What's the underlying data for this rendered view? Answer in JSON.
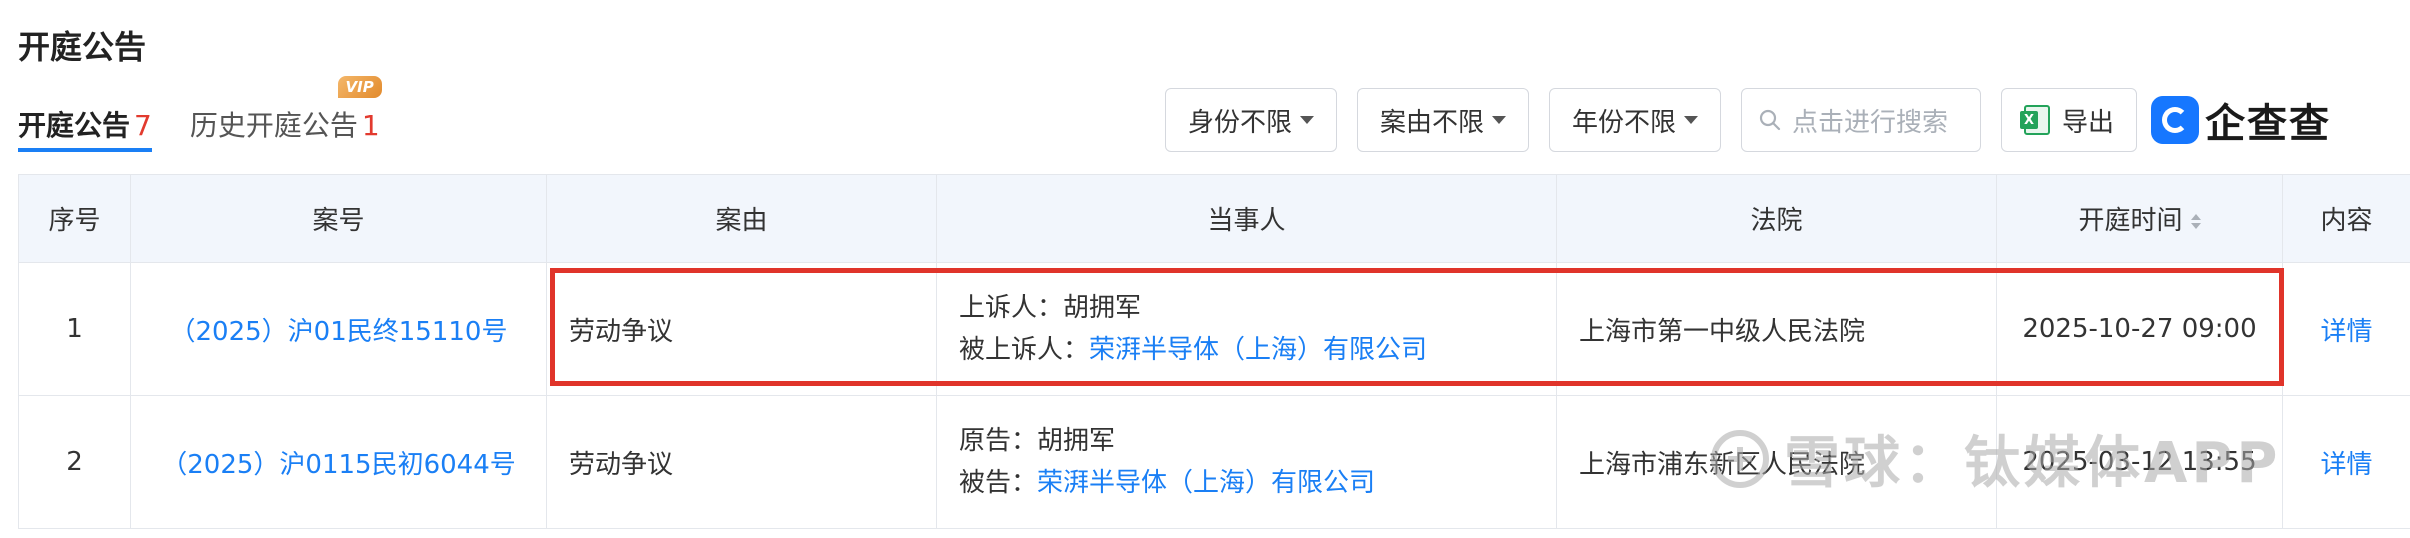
{
  "page": {
    "title": "开庭公告"
  },
  "tabs": [
    {
      "label": "开庭公告",
      "count": "7"
    },
    {
      "label": "历史开庭公告",
      "count": "1",
      "badge": "VIP"
    }
  ],
  "filters": {
    "identity": "身份不限",
    "cause": "案由不限",
    "year": "年份不限",
    "search_placeholder": "点击进行搜索",
    "export": "导出"
  },
  "brand": {
    "name": "企查查"
  },
  "table": {
    "headers": [
      "序号",
      "案号",
      "案由",
      "当事人",
      "法院",
      "开庭时间",
      "内容"
    ],
    "rows": [
      {
        "index": "1",
        "case_no": "（2025）沪01民终15110号",
        "cause": "劳动争议",
        "party1_role": "上诉人：",
        "party1_name": "胡拥军",
        "party2_role": "被上诉人：",
        "party2_name": "荣湃半导体（上海）有限公司",
        "court": "上海市第一中级人民法院",
        "time": "2025-10-27 09:00",
        "action": "详情"
      },
      {
        "index": "2",
        "case_no": "（2025）沪0115民初6044号",
        "cause": "劳动争议",
        "party1_role": "原告：",
        "party1_name": "胡拥军",
        "party2_role": "被告：",
        "party2_name": "荣湃半导体（上海）有限公司",
        "court": "上海市浦东新区人民法院",
        "time": "2025-03-12 13:55",
        "action": "详情"
      }
    ]
  },
  "watermark": {
    "text": "雪球：钛媒体APP"
  },
  "colors": {
    "accent": "#1a7ff5",
    "highlight": "#e0342a",
    "count": "#e23a2e",
    "header_bg": "#f2f6fc"
  }
}
